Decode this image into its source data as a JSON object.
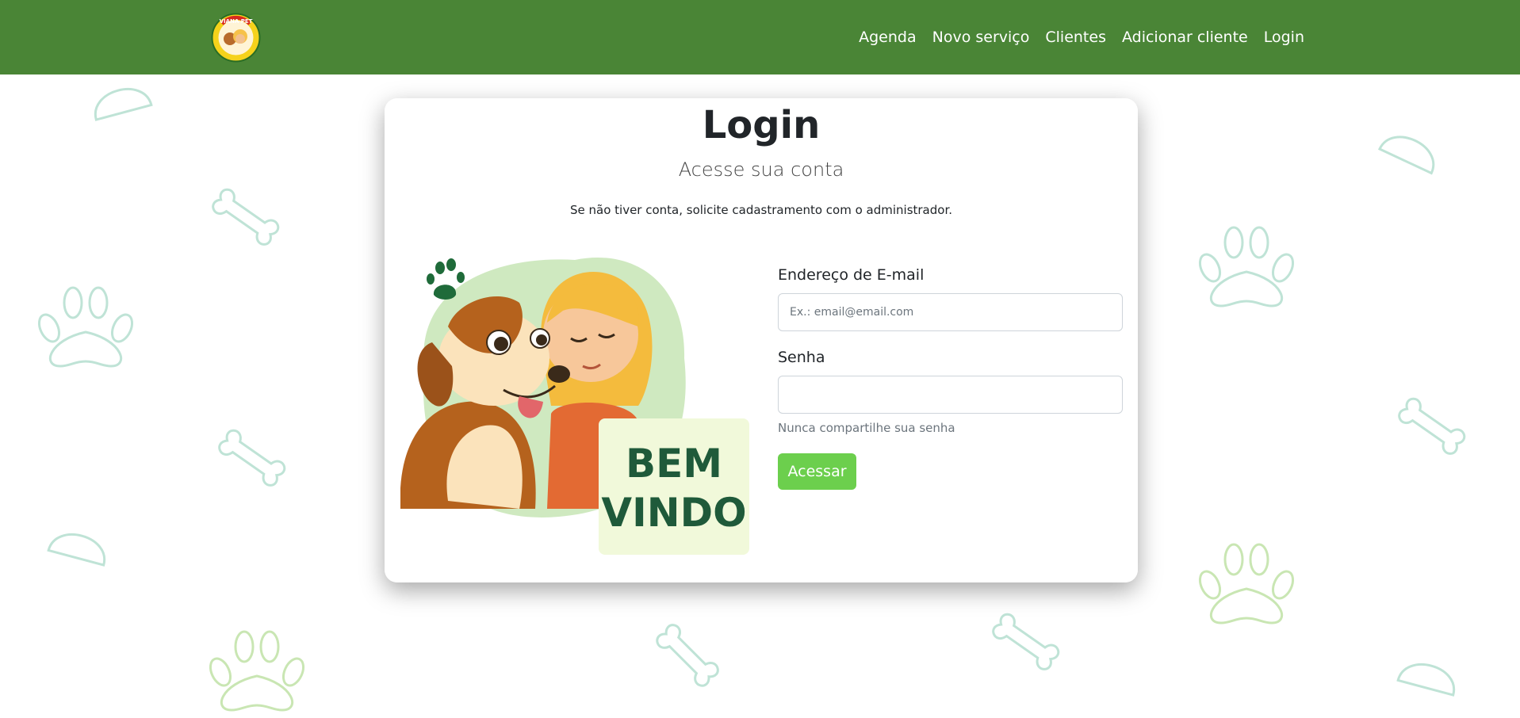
{
  "nav": {
    "logo_text": "VIANA PET",
    "links": [
      "Agenda",
      "Novo serviço",
      "Clientes",
      "Adicionar cliente",
      "Login"
    ]
  },
  "login": {
    "title": "Login",
    "subtitle": "Acesse sua conta",
    "note": "Se não tiver conta, solicite cadastramento com o administrador."
  },
  "illustration": {
    "banner_line1": "BEM",
    "banner_line2": "VINDO"
  },
  "form": {
    "email_label": "Endereço de E-mail",
    "email_placeholder": "Ex.: email@email.com",
    "email_value": "",
    "password_label": "Senha",
    "password_value": "",
    "password_help": "Nunca compartilhe sua senha",
    "submit_label": "Acessar"
  },
  "colors": {
    "navbar": "#4a8536",
    "button": "#6ccf4d",
    "pattern_teal": "#bfe3d6",
    "pattern_green": "#c9e6b3"
  },
  "icons": [
    "paw-icon",
    "bone-icon",
    "bowl-icon"
  ]
}
